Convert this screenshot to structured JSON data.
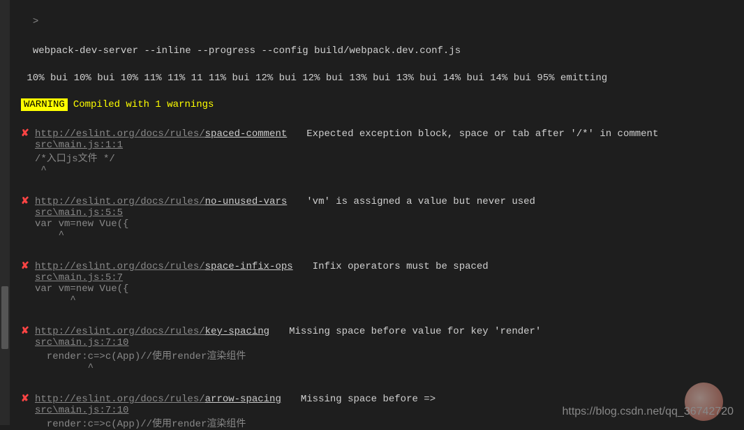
{
  "command": {
    "prefix": ">",
    "text": "webpack-dev-server --inline --progress --config build/webpack.dev.conf.js"
  },
  "progress": " 10% bui 10% bui 10% 11% 11% 11 11% bui 12% bui 12% bui 13% bui 13% bui 14% bui 14% bui 95% emitting",
  "warning": {
    "badge": " WARNING ",
    "text": "Compiled with 1 warnings"
  },
  "link_base": "http://eslint.org/docs/rules/",
  "errors": [
    {
      "rule": "spaced-comment",
      "message": "Expected exception block, space or tab after '/*' in comment",
      "location": "src\\main.js:1:1",
      "code": "/*入口js文件 */",
      "caret": " ^"
    },
    {
      "rule": "no-unused-vars",
      "message": "'vm' is assigned a value but never used",
      "location": "src\\main.js:5:5",
      "code": "var vm=new Vue({",
      "caret": "    ^"
    },
    {
      "rule": "space-infix-ops",
      "message": "Infix operators must be spaced",
      "location": "src\\main.js:5:7",
      "code": "var vm=new Vue({",
      "caret": "      ^"
    },
    {
      "rule": "key-spacing",
      "message": "Missing space before value for key 'render'",
      "location": "src\\main.js:7:10",
      "code": "  render:c=>c(App)//使用render渲染组件",
      "caret": "         ^"
    },
    {
      "rule": "arrow-spacing",
      "message": "Missing space before =>",
      "location": "src\\main.js:7:10",
      "code": "  render:c=>c(App)//使用render渲染组件",
      "caret": ""
    }
  ],
  "x_mark": "✘",
  "watermark": "https://blog.csdn.net/qq_36742720"
}
